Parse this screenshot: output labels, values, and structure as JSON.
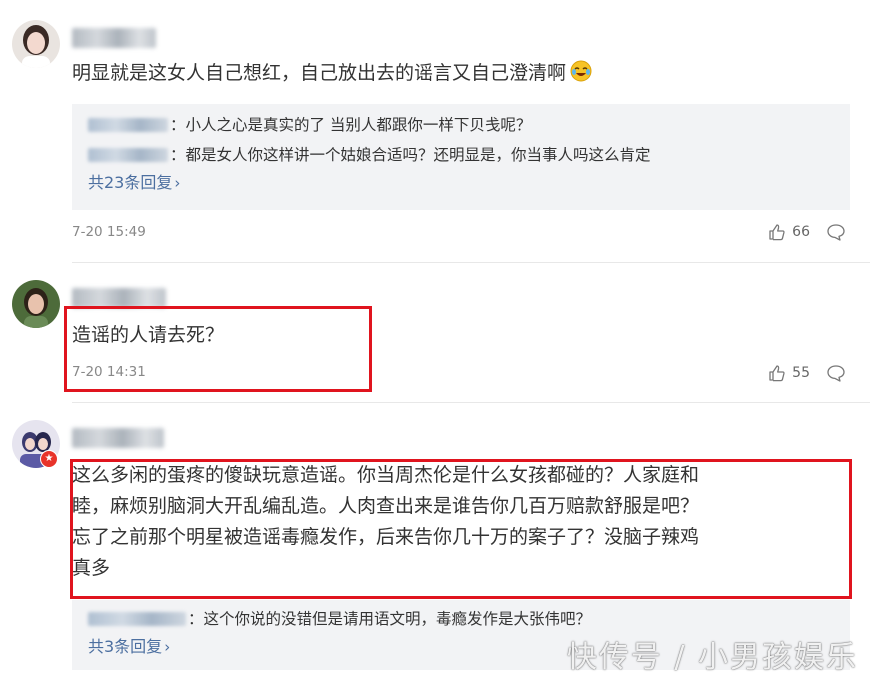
{
  "comments": [
    {
      "text": "明显就是这女人自己想红，自己放出去的谣言又自己澄清啊",
      "emoji": "crying-laughing-emoji",
      "replies": [
        {
          "text": "：小人之心是真实的了 当别人都跟你一样下贝戋呢？"
        },
        {
          "text": "：都是女人你这样讲一个姑娘合适吗？还明显是，你当事人吗这么肯定"
        }
      ],
      "more_replies": "共23条回复",
      "time": "7-20 15:49",
      "likes": "66"
    },
    {
      "text": "造谣的人请去死？",
      "time": "7-20 14:31",
      "likes": "55"
    },
    {
      "lines": [
        "这么多闲的蛋疼的傻缺玩意造谣。你当周杰伦是什么女孩都碰的？人家庭和",
        "睦，麻烦别脑洞大开乱编乱造。人肉查出来是谁告你几百万赔款舒服是吧？",
        "忘了之前那个明星被造谣毒瘾发作，后来告你几十万的案子了？没脑子辣鸡",
        "真多"
      ],
      "replies": [
        {
          "text": "：这个你说的没错但是请用语文明，毒瘾发作是大张伟吧？"
        }
      ],
      "more_replies": "共3条回复"
    }
  ],
  "watermark": "快传号 / 小男孩娱乐",
  "colors": {
    "link": "#4c6fa0",
    "highlight_box": "#e0141e",
    "reply_bg": "#f2f3f5"
  }
}
